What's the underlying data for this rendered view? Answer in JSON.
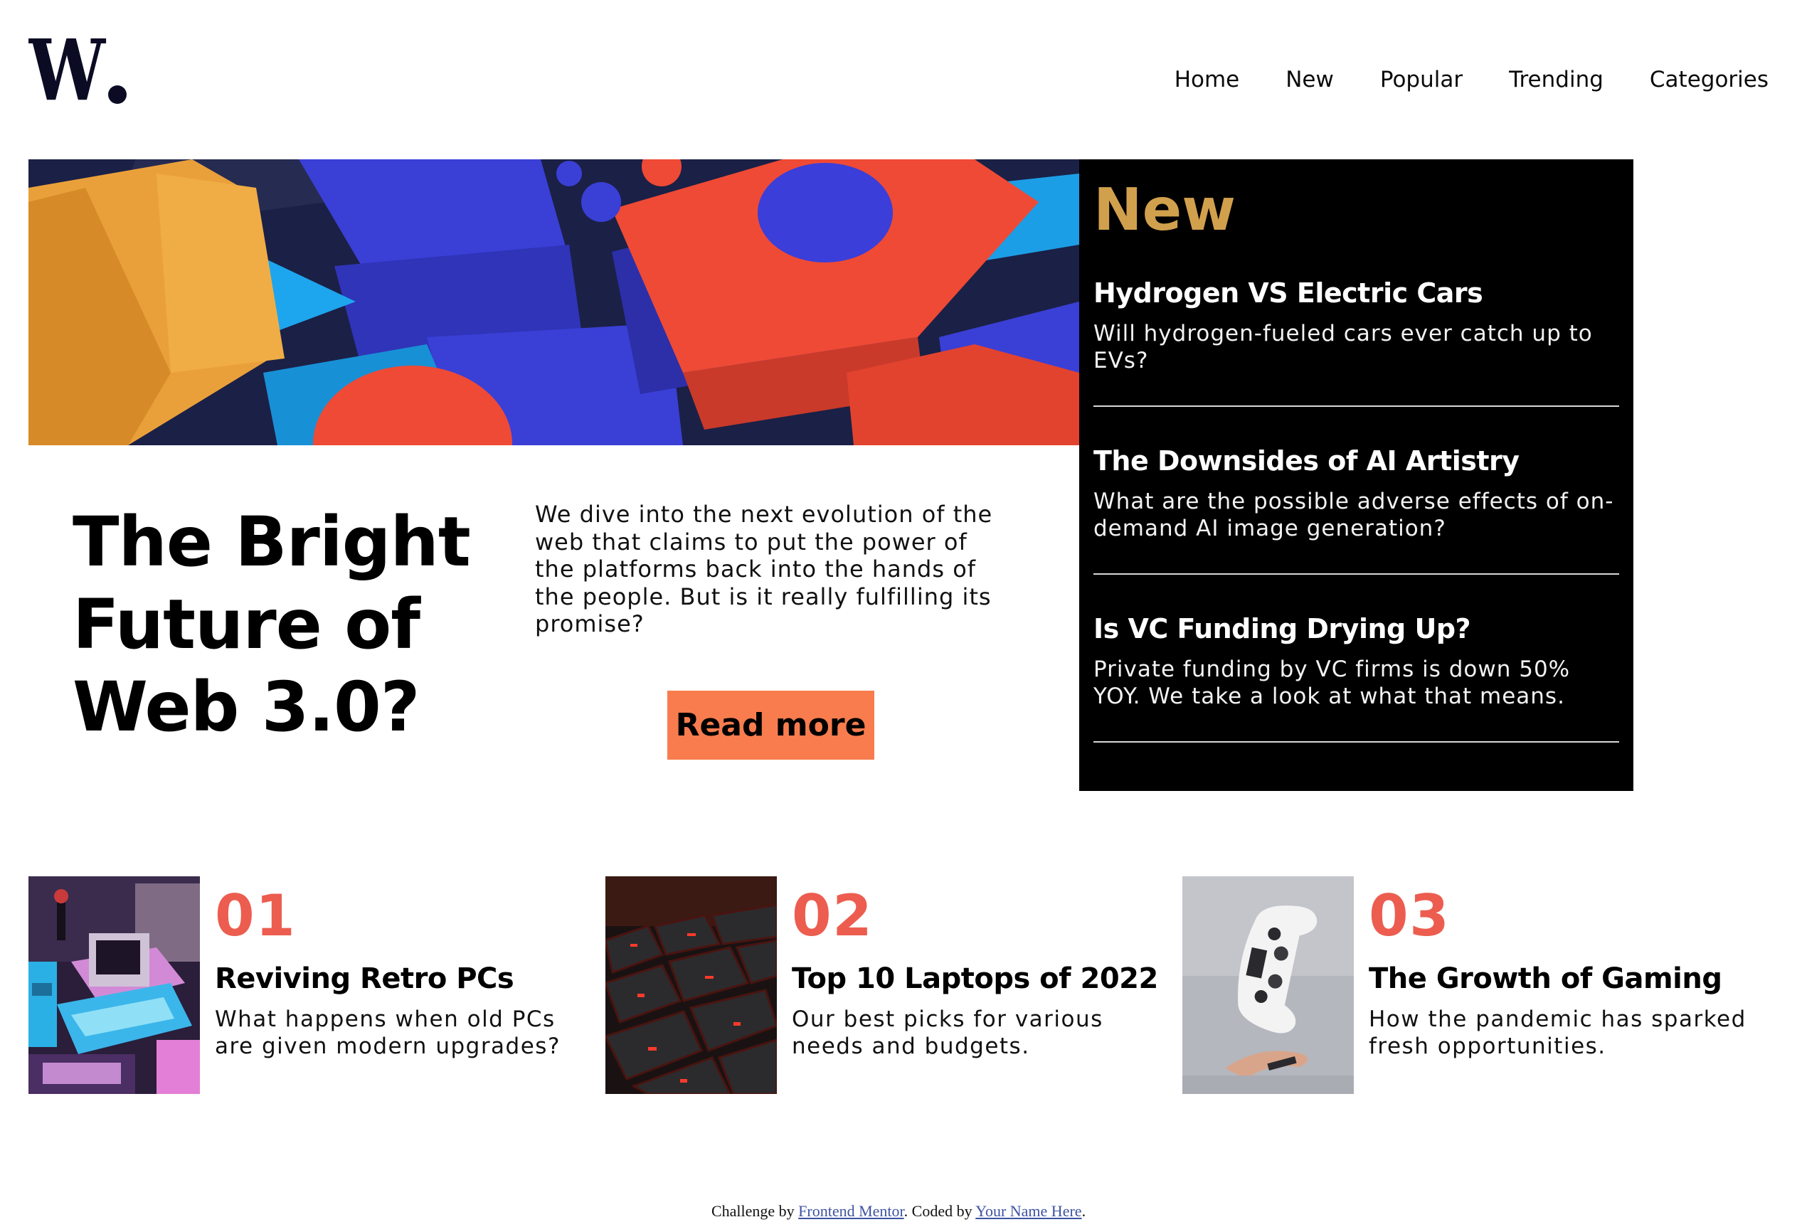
{
  "header": {
    "logo_text": "W.",
    "nav": [
      "Home",
      "New",
      "Popular",
      "Trending",
      "Categories"
    ]
  },
  "hero": {
    "title": "The Bright Future of Web 3.0?",
    "description": "We dive into the next evolution of the web that claims to put the power of the platforms back into the hands of the people. But is it really fulfilling its promise?",
    "button_label": "Read more",
    "image_icon": "abstract-blocks-image"
  },
  "new_panel": {
    "heading": "New",
    "items": [
      {
        "title": "Hydrogen VS Electric Cars",
        "text": "Will hydrogen-fueled cars ever catch up to EVs?"
      },
      {
        "title": "The Downsides of AI Artistry",
        "text": "What are the possible adverse effects of on-demand AI image generation?"
      },
      {
        "title": "Is VC Funding Drying Up?",
        "text": "Private funding by VC firms is down 50% YOY. We take a look at what that means."
      }
    ]
  },
  "articles": [
    {
      "number": "01",
      "title": "Reviving Retro PCs",
      "text": "What happens when old PCs are given modern upgrades?",
      "image_icon": "retro-pc-image"
    },
    {
      "number": "02",
      "title": "Top 10 Laptops of 2022",
      "text": "Our best picks for various needs and budgets.",
      "image_icon": "laptop-keyboard-image"
    },
    {
      "number": "03",
      "title": "The Growth of Gaming",
      "text": "How the pandemic has sparked fresh opportunities.",
      "image_icon": "game-controller-image"
    }
  ],
  "footer": {
    "prefix": "Challenge by ",
    "link1": "Frontend Mentor",
    "middle": ". Coded by ",
    "link2": "Your Name Here",
    "suffix": "."
  },
  "colors": {
    "accent_orange": "#f87c4e",
    "number_red": "#ec5d4f",
    "new_gold": "#d1a04d",
    "panel_black": "#000000"
  }
}
